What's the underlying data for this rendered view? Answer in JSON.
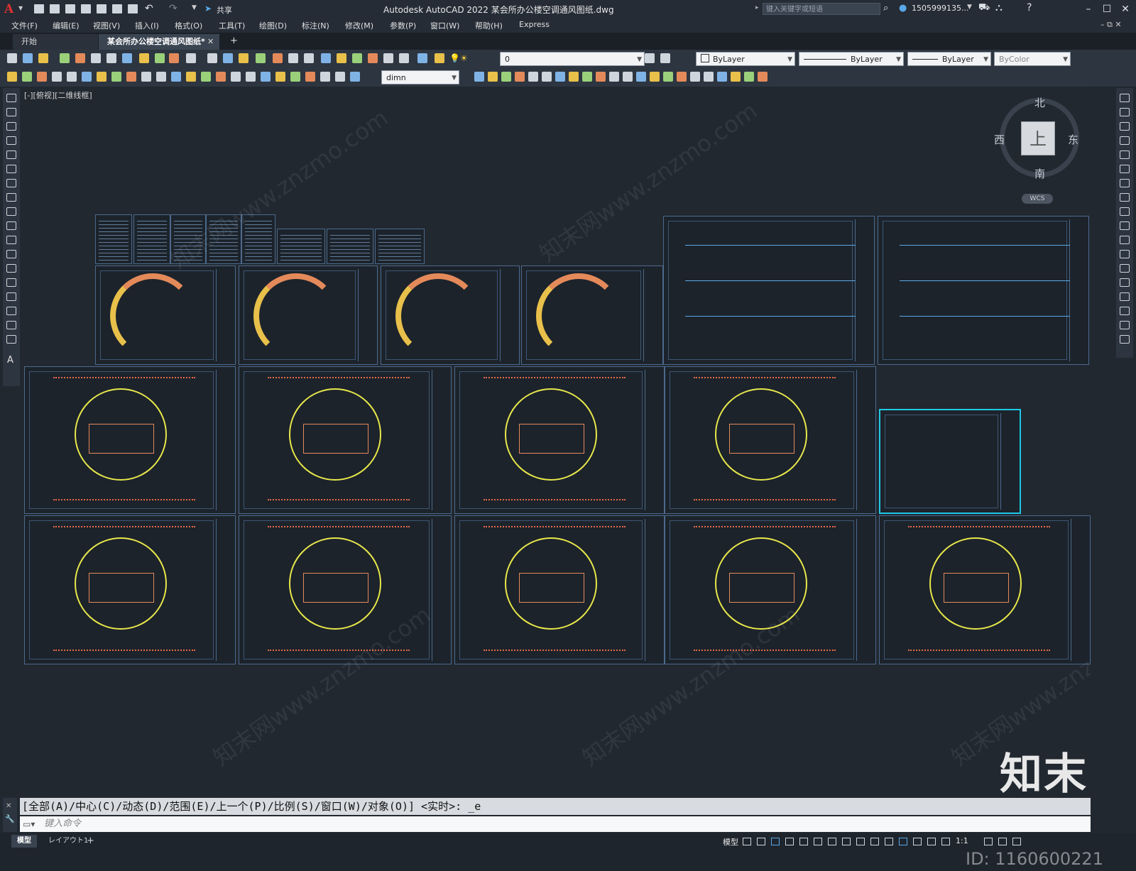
{
  "app": {
    "title": "Autodesk AutoCAD 2022    某会所办公楼空调通风图纸.dwg",
    "share_label": "共享",
    "search_placeholder": "键入关键字或短语",
    "user": "1505999135...",
    "logo_letter": "A"
  },
  "menu": [
    "文件(F)",
    "编辑(E)",
    "视图(V)",
    "插入(I)",
    "格式(O)",
    "工具(T)",
    "绘图(D)",
    "标注(N)",
    "修改(M)",
    "参数(P)",
    "窗口(W)",
    "帮助(H)",
    "Express"
  ],
  "tabs": {
    "start": "开始",
    "doc": "某会所办公楼空调通风图纸*",
    "close": "✕",
    "add": "+"
  },
  "properties": {
    "layer_value": "0",
    "color": "ByLayer",
    "linetype": "ByLayer",
    "lineweight": "ByLayer",
    "plotstyle": "ByColor",
    "dimstyle": "dimn"
  },
  "viewport": {
    "label": "[-][俯视][二维线框]"
  },
  "viewcube": {
    "north": "北",
    "south": "南",
    "east": "东",
    "west": "西",
    "face": "上",
    "wcs": "WCS"
  },
  "command": {
    "history": "[全部(A)/中心(C)/动态(D)/范围(E)/上一个(P)/比例(S)/窗口(W)/对象(O)] <实时>: _e",
    "placeholder": "键入命令"
  },
  "status": {
    "tab_model": "模型",
    "tab_layout": "レイアウト1",
    "add": "+",
    "model_btn": "模型",
    "scale": "1:1"
  },
  "watermark": {
    "brand": "知末",
    "id": "ID: 1160600221",
    "site": "知末网www.znzmo.com"
  },
  "colors": {
    "canvas_bg": "#212830",
    "sheet_border": "#4c6a8c",
    "highlight": "#1ec8e6",
    "accent": "#e03030"
  }
}
